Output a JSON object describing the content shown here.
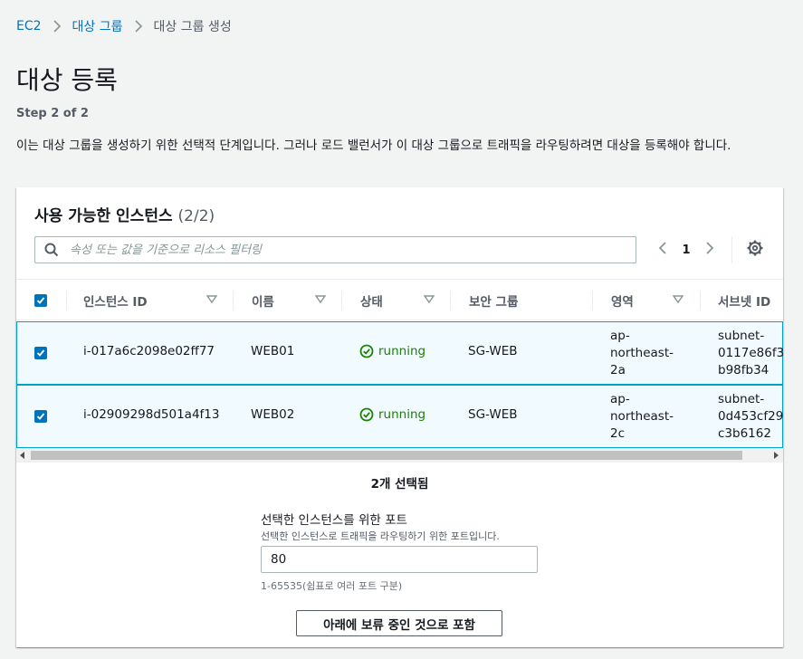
{
  "breadcrumb": {
    "items": [
      {
        "label": "EC2"
      },
      {
        "label": "대상 그룹"
      },
      {
        "label": "대상 그룹 생성"
      }
    ]
  },
  "page": {
    "title": "대상 등록",
    "step": "Step 2 of 2",
    "description": "이는 대상 그룹을 생성하기 위한 선택적 단계입니다. 그러나 로드 밸런서가 이 대상 그룹으로 트래픽을 라우팅하려면 대상을 등록해야 합니다."
  },
  "instances_panel": {
    "title": "사용 가능한 인스턴스",
    "count": "(2/2)",
    "filter_placeholder": "속성 또는 값을 기준으로 리소스 필터링",
    "current_page": "1",
    "columns": [
      "인스턴스 ID",
      "이름",
      "상태",
      "보안 그룹",
      "영역",
      "서브넷 ID"
    ],
    "rows": [
      {
        "instance_id": "i-017a6c2098e02ff77",
        "name": "WEB01",
        "status": "running",
        "security_group": "SG-WEB",
        "zone_lines": [
          "ap-",
          "northeast-",
          "2a"
        ],
        "subnet_lines": [
          "subnet-",
          "0117e86f3",
          "b98fb34"
        ]
      },
      {
        "instance_id": "i-02909298d501a4f13",
        "name": "WEB02",
        "status": "running",
        "security_group": "SG-WEB",
        "zone_lines": [
          "ap-",
          "northeast-",
          "2c"
        ],
        "subnet_lines": [
          "subnet-",
          "0d453cf29",
          "c3b6162"
        ]
      }
    ],
    "selected_count": "2개 선택됨"
  },
  "port": {
    "label": "선택한 인스턴스를 위한 포트",
    "description": "선택한 인스턴스로 트래픽을 라우팅하기 위한 포트입니다.",
    "value": "80",
    "hint": "1-65535(쉼표로 여러 포트 구분)",
    "include_button": "아래에 보류 중인 것으로 포함"
  },
  "colors": {
    "link": "#0073bb",
    "selected_row_bg": "#f1faff",
    "selected_row_border": "#00a1c9",
    "running_green": "#1d8102"
  }
}
